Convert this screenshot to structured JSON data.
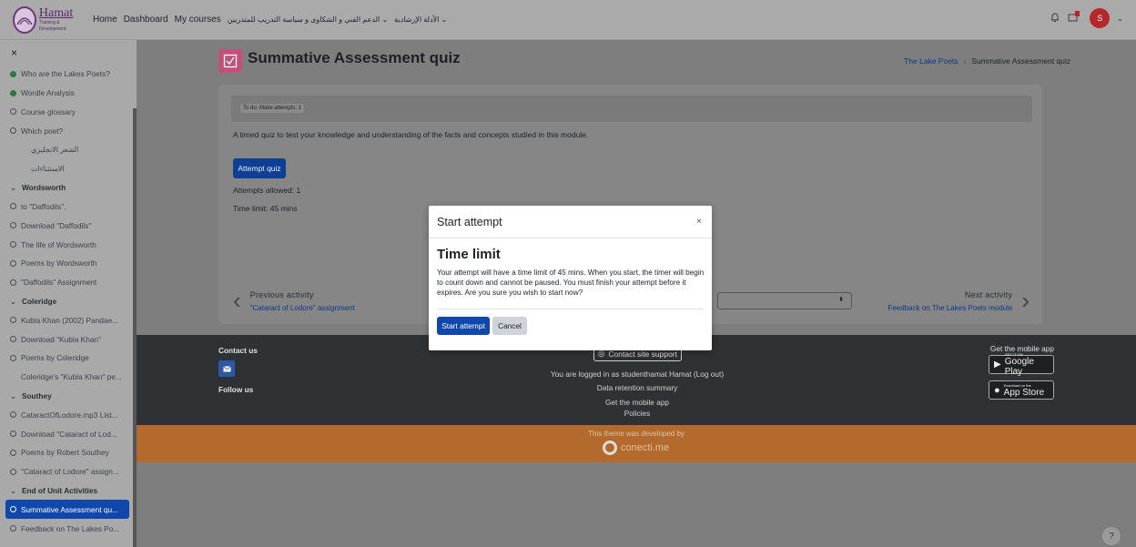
{
  "header": {
    "logo_text": "Hamat",
    "logo_subtext": "Training & Development",
    "nav": [
      "Home",
      "Dashboard",
      "My courses",
      "الدعم الفني و الشكاوى و سياسة التدريب للمتدربين ⌄",
      "الأدلة الإرشادية ⌄"
    ],
    "user_initial": "S",
    "bell_icon": "bell-icon",
    "messages_icon": "chat-icon"
  },
  "sidebar": {
    "close_label": "×",
    "items": [
      {
        "label": "Who are the Lakes Poets?",
        "type": "done"
      },
      {
        "label": "Wordle Analysis",
        "type": "done"
      },
      {
        "label": "Course glossary",
        "type": "todo"
      },
      {
        "label": "Which poet?",
        "type": "todo"
      },
      {
        "label": "الشعر الانجليزي",
        "type": "ar"
      },
      {
        "label": "الاستثناءات",
        "type": "ar"
      },
      {
        "label": "Wordsworth",
        "type": "section"
      },
      {
        "label": "to \"Daffodils\".",
        "type": "todo"
      },
      {
        "label": "Download \"Daffodils\"",
        "type": "todo"
      },
      {
        "label": "The life of Wordsworth",
        "type": "todo"
      },
      {
        "label": "Poems by Wordsworth",
        "type": "todo"
      },
      {
        "label": "\"Daffodils\" Assignment",
        "type": "todo"
      },
      {
        "label": "Coleridge",
        "type": "section"
      },
      {
        "label": "Kubla Khan (2002) Pandae...",
        "type": "todo"
      },
      {
        "label": "Download \"Kubla Khan\"",
        "type": "todo"
      },
      {
        "label": "Poems by Coleridge",
        "type": "todo"
      },
      {
        "label": "Coleridge's \"Kubla Khan\" pe...",
        "type": "plain"
      },
      {
        "label": "Southey",
        "type": "section"
      },
      {
        "label": "CataractOfLodore.mp3 List...",
        "type": "todo"
      },
      {
        "label": "Download \"Cataract of Lod...",
        "type": "todo"
      },
      {
        "label": "Poems by Robert Southey",
        "type": "todo"
      },
      {
        "label": "\"Cataract of Lodore\" assign...",
        "type": "todo"
      },
      {
        "label": "End of Unit Activities",
        "type": "section"
      },
      {
        "label": "Summative Assessment qu...",
        "type": "active"
      },
      {
        "label": "Feedback on The Lakes Po...",
        "type": "todo"
      }
    ]
  },
  "page": {
    "title": "Summative Assessment quiz",
    "breadcrumb_link": "The Lake Poets",
    "breadcrumb_current": "Summative Assessment quiz",
    "todo_label": "To do: Make attempts: 1",
    "description": "A timed quiz to test your knowledge and understanding of the facts and concepts studied in this module.",
    "attempt_button": "Attempt quiz",
    "attempts_allowed": "Attempts allowed: 1",
    "time_limit": "Time limit: 45 mins"
  },
  "activity_nav": {
    "prev_heading": "Previous activity",
    "prev_link": "\"Cataract of Lodore\" assignment",
    "next_heading": "Next activity",
    "next_link": "Feedback on The Lakes Poets module"
  },
  "footer": {
    "contact_us": "Contact us",
    "follow_us": "Follow us",
    "support_button": "Contact site support",
    "logged_in": "You are logged in as studenthamat Hamat (Log out)",
    "data_retention": "Data retention summary",
    "get_app_link": "Get the mobile app",
    "policies": "Policies",
    "mobile_app_heading": "Get the mobile app",
    "google_small": "GET IT ON",
    "google_big": "Google Play",
    "apple_small": "Download on the",
    "apple_big": "App Store",
    "developed_by": "This theme was developed by",
    "brand": "conecti.me"
  },
  "modal": {
    "title": "Start attempt",
    "close": "×",
    "heading": "Time limit",
    "text": "Your attempt will have a time limit of 45 mins. When you start, the timer will begin to count down and cannot be paused. You must finish your attempt before it expires. Are you sure you wish to start now?",
    "start_button": "Start attempt",
    "cancel_button": "Cancel"
  },
  "help": "?"
}
